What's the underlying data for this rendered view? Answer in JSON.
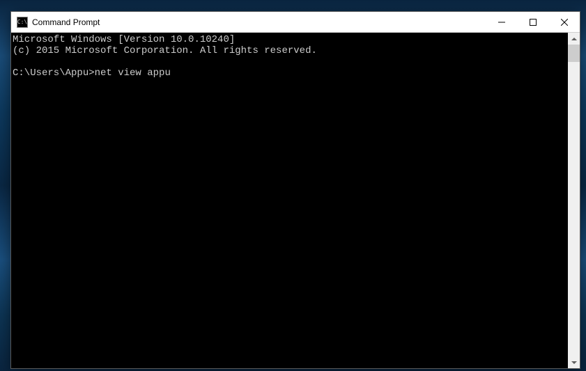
{
  "window": {
    "title": "Command Prompt"
  },
  "console": {
    "line1": "Microsoft Windows [Version 10.0.10240]",
    "line2": "(c) 2015 Microsoft Corporation. All rights reserved.",
    "blank": "",
    "prompt": "C:\\Users\\Appu>",
    "command": "net view appu"
  }
}
